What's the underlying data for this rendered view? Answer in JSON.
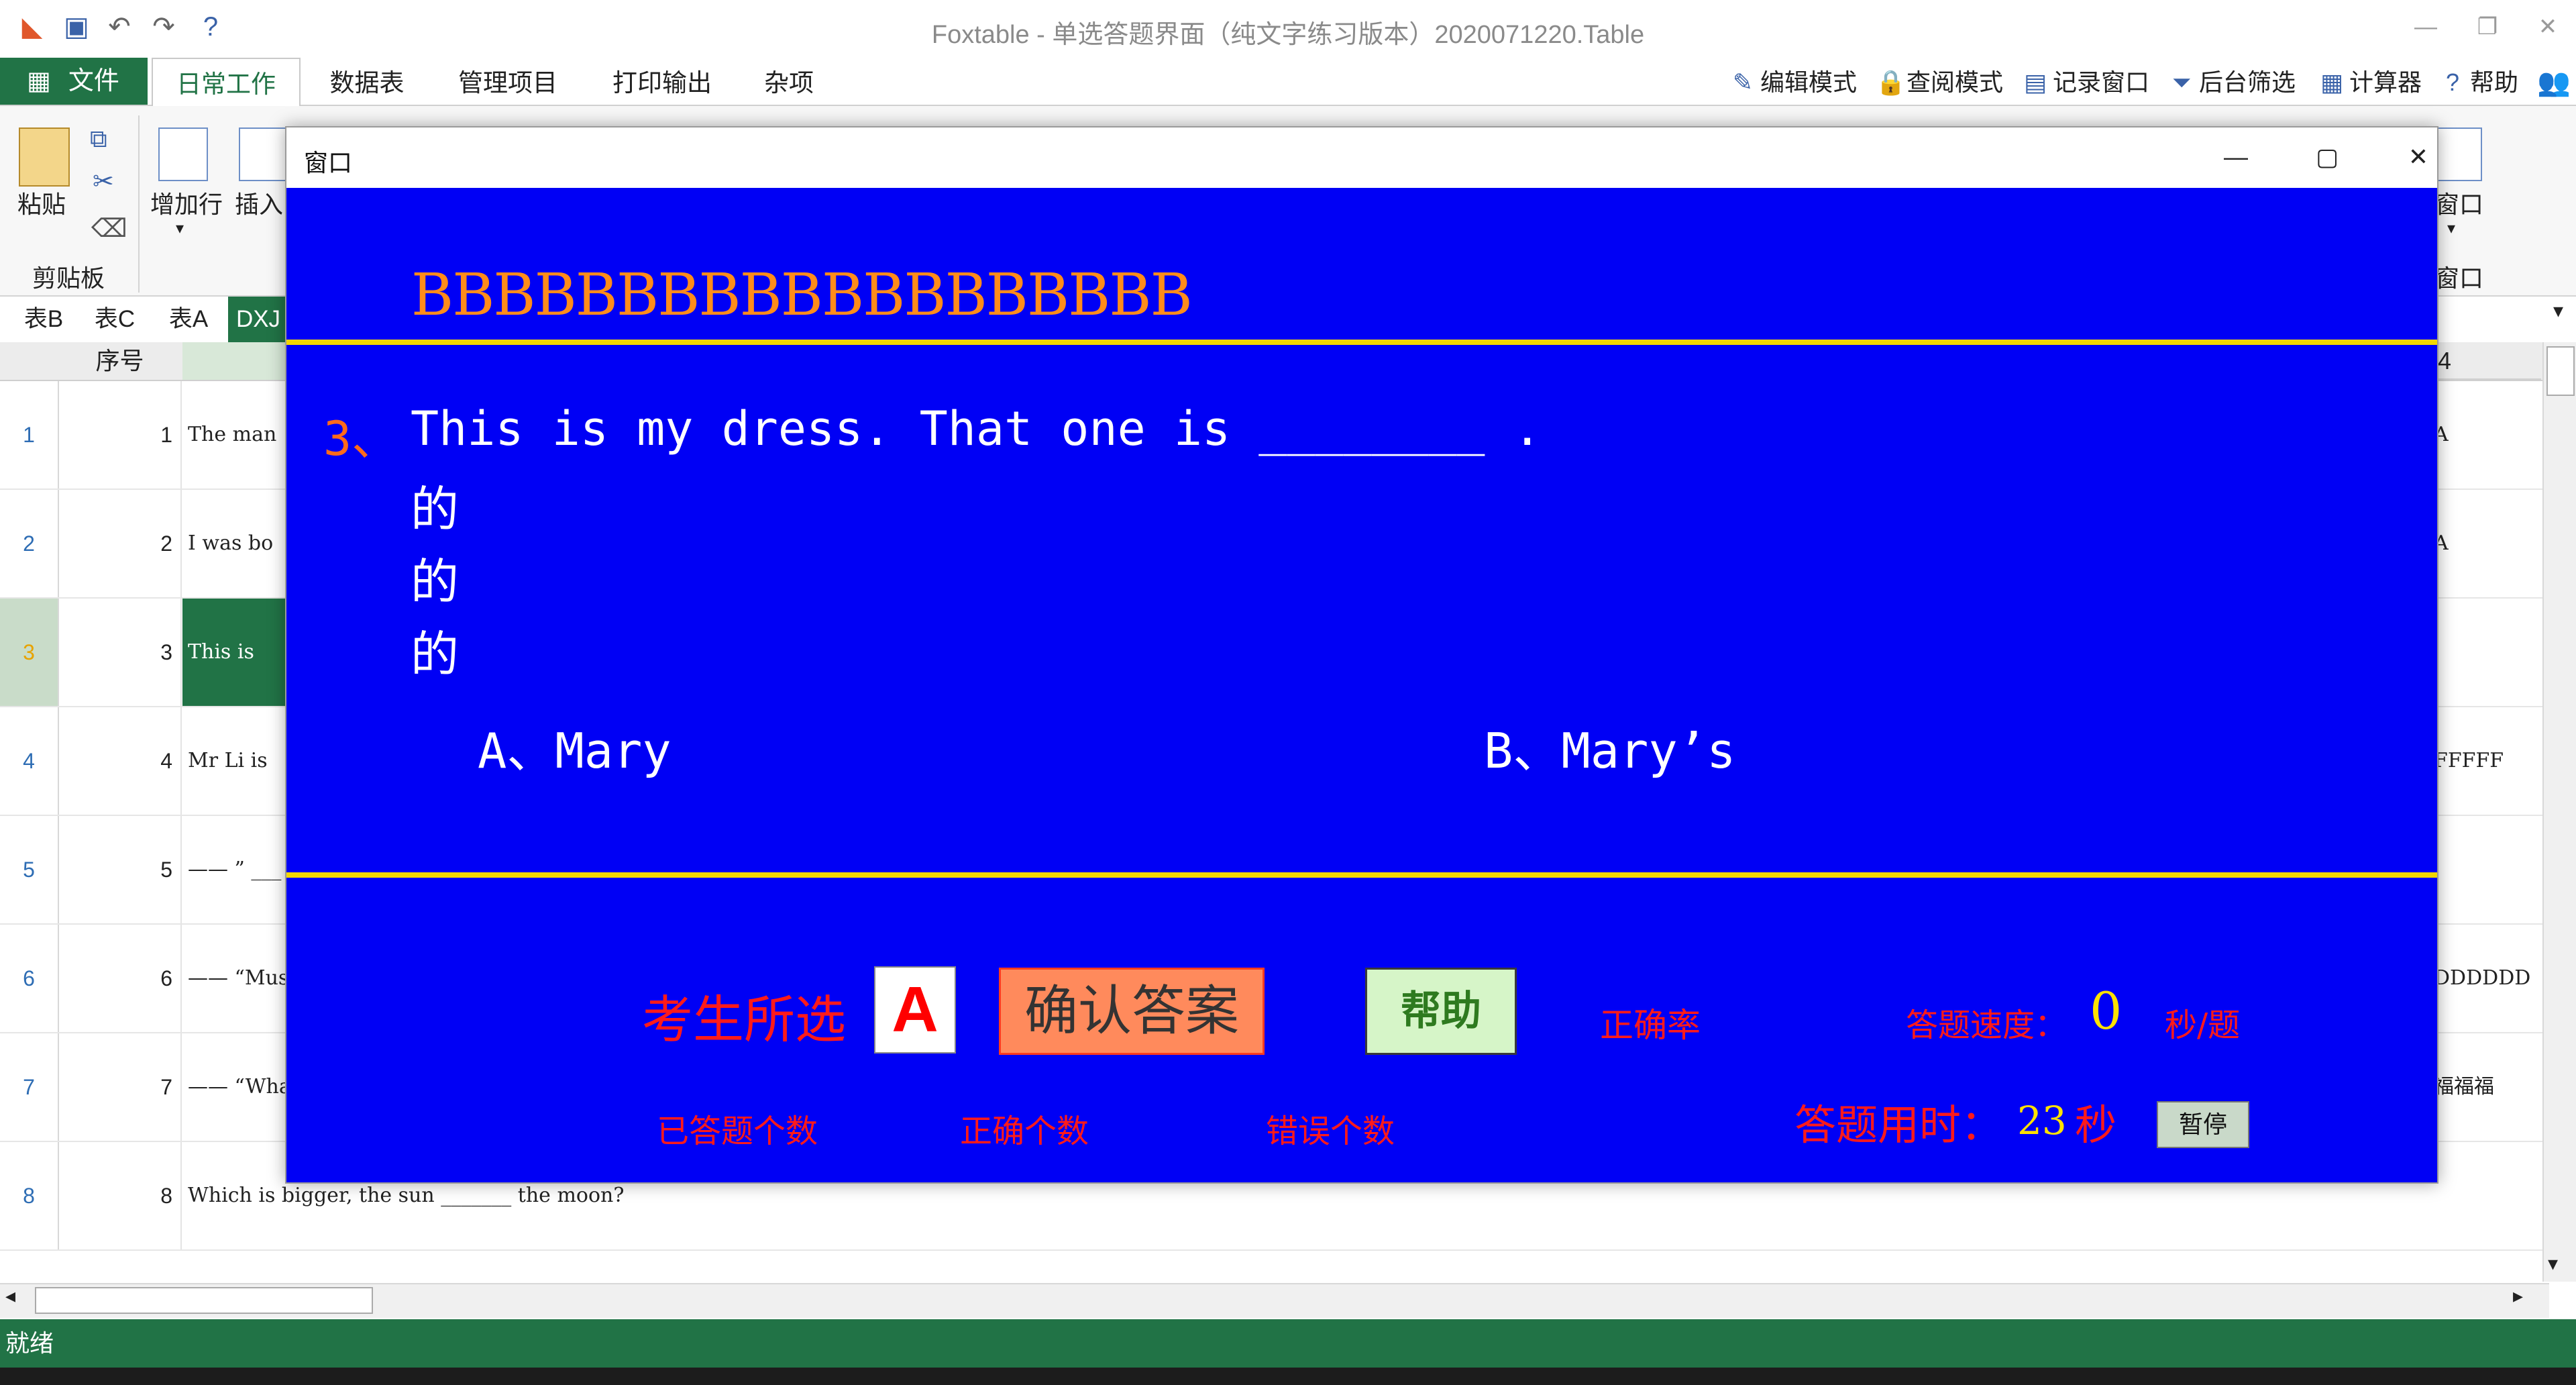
{
  "app": {
    "title": "Foxtable - 单选答题界面（纯文字练习版本）2020071220.Table"
  },
  "menu": {
    "file": "文件",
    "tabs": [
      "日常工作",
      "数据表",
      "管理项目",
      "打印输出",
      "杂项"
    ],
    "right": [
      "编辑模式",
      "查阅模式",
      "记录窗口",
      "后台筛选",
      "计算器",
      "帮助"
    ]
  },
  "ribbon": {
    "paste": "粘贴",
    "add_row": "增加行",
    "insert": "插入",
    "clipboard_group": "剪贴板",
    "window": "窗口",
    "window_group": "窗口"
  },
  "sheet_tabs": [
    "表B",
    "表C",
    "表A",
    "DXJ"
  ],
  "grid": {
    "seq_header": "序号",
    "rows": [
      {
        "num": "1",
        "seq": "1",
        "text": "The man",
        "right": "A"
      },
      {
        "num": "2",
        "seq": "2",
        "text": "I was bo",
        "right": "A"
      },
      {
        "num": "3",
        "seq": "3",
        "text": "This is",
        "right": ""
      },
      {
        "num": "4",
        "seq": "4",
        "text": "Mr Li is",
        "right": "FFFFF"
      },
      {
        "num": "5",
        "seq": "5",
        "text": "—— ” ___",
        "right": ""
      },
      {
        "num": "6",
        "seq": "6",
        "text": "—— “Mus",
        "right": "DDDDDD"
      },
      {
        "num": "7",
        "seq": "7",
        "text": "—— “Wha",
        "right": "福福福"
      },
      {
        "num": "8",
        "seq": "8",
        "text": "Which is bigger, the sun _______ the moon?",
        "right": ""
      }
    ],
    "right_header": "4"
  },
  "status": {
    "text": "就绪"
  },
  "dialog": {
    "title": "窗口",
    "banner": "BBBBBBBBBBBBBBBBBBB",
    "question_number": "3、",
    "question_text": "This is my dress. That one is ________ .",
    "de_lines": [
      "的",
      "的",
      "的"
    ],
    "option_a": "A、Mary",
    "option_b": "B、Mary’s",
    "selected_label": "考生所选",
    "selected_value": "A",
    "confirm_label": "确认答案",
    "help_label": "帮助",
    "accuracy_label": "正确率",
    "speed_label": "答题速度：",
    "speed_value": "0",
    "speed_unit": "秒/题",
    "answered_label": "已答题个数",
    "correct_label": "正确个数",
    "wrong_label": "错误个数",
    "time_label": "答题用时：",
    "time_value": "23",
    "time_unit": "秒",
    "pause_label": "暂停"
  },
  "colors": {
    "excel_green": "#217346",
    "dialog_blue": "#0000f5",
    "accent_orange": "#ff8c1a",
    "rule_yellow": "#f2d600",
    "label_red": "#ff1a1a"
  }
}
